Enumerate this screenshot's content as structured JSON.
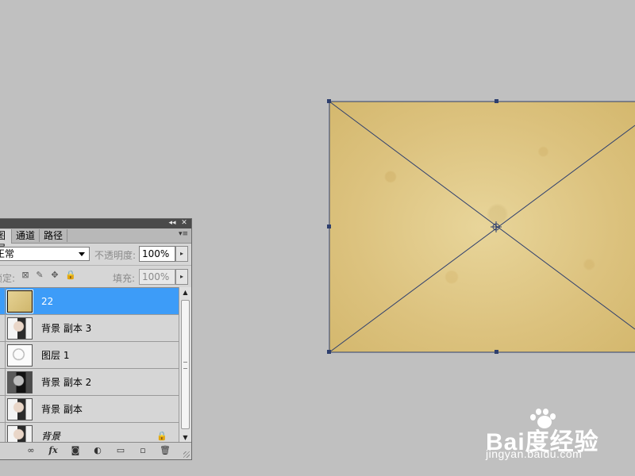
{
  "layers_panel": {
    "tabs": [
      {
        "label": "图层",
        "active": true
      },
      {
        "label": "通道",
        "active": false
      },
      {
        "label": "路径",
        "active": false
      }
    ],
    "titlebar": {
      "collapse_glyph": "◂◂",
      "close_glyph": "✕"
    },
    "panel_menu_glyph": "▾≡",
    "blend_mode": "正常",
    "opacity_label": "不透明度:",
    "opacity_value": "100%",
    "lock_label": "锁定:",
    "fill_label": "填充:",
    "fill_value": "100%",
    "stepper_glyph": "▸",
    "layers": [
      {
        "name": "22",
        "thumbnail": "texture",
        "selected": true,
        "locked": false
      },
      {
        "name": "背景 副本 3",
        "thumbnail": "photo",
        "selected": false,
        "locked": false
      },
      {
        "name": "图层 1",
        "thumbnail": "sketch",
        "selected": false,
        "locked": false
      },
      {
        "name": "背景 副本 2",
        "thumbnail": "dark-photo",
        "selected": false,
        "locked": false
      },
      {
        "name": "背景 副本",
        "thumbnail": "photo",
        "selected": false,
        "locked": false
      },
      {
        "name": "背景",
        "thumbnail": "photo",
        "selected": false,
        "locked": true
      }
    ],
    "footer_buttons": [
      {
        "name": "link-layers",
        "glyph": "∞"
      },
      {
        "name": "layer-style",
        "glyph": "fx"
      },
      {
        "name": "add-mask",
        "glyph": "◙"
      },
      {
        "name": "adjustment-layer",
        "glyph": "◐"
      },
      {
        "name": "new-group",
        "glyph": "▭"
      },
      {
        "name": "new-layer",
        "glyph": "▫"
      },
      {
        "name": "delete-layer",
        "glyph": "🗑"
      }
    ],
    "colors": {
      "selection": "#3d9cf8",
      "panel_bg": "#d6d6d6"
    }
  },
  "canvas": {
    "background_color": "#c0c0c0",
    "texture_color": "#dcc27e",
    "transform_line_color": "#2e3f6e"
  },
  "watermark": {
    "brand": "Bai度经验",
    "url": "jingyan.baidu.com"
  }
}
